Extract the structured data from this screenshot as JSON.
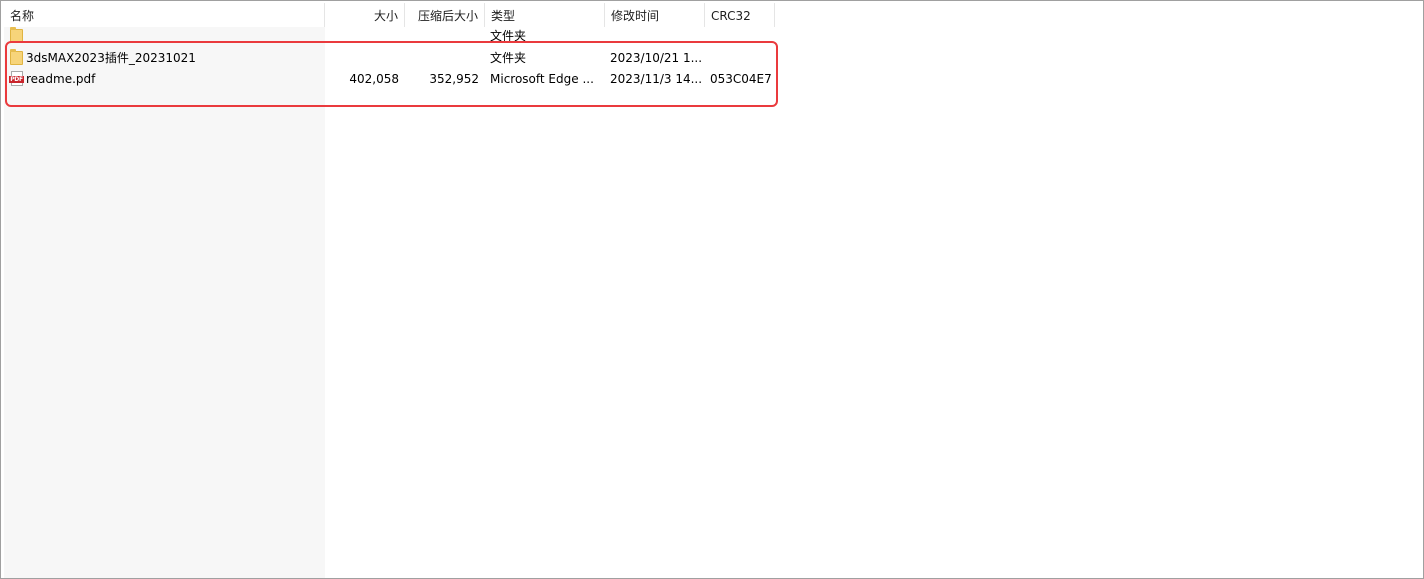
{
  "columns": {
    "name": "名称",
    "size": "大小",
    "packed_size": "压缩后大小",
    "type": "类型",
    "modified": "修改时间",
    "crc": "CRC32"
  },
  "rows": [
    {
      "icon": "folder-icon",
      "name": "",
      "size": "",
      "packed_size": "",
      "type": "文件夹",
      "modified": "",
      "crc": ""
    },
    {
      "icon": "folder-icon",
      "name": "3dsMAX2023插件_20231021",
      "size": "",
      "packed_size": "",
      "type": "文件夹",
      "modified": "2023/10/21 1...",
      "crc": ""
    },
    {
      "icon": "pdf-icon",
      "icon_label": "PDF",
      "name": "readme.pdf",
      "size": "402,058",
      "packed_size": "352,952",
      "type": "Microsoft Edge ...",
      "modified": "2023/11/3 14...",
      "crc": "053C04E7"
    }
  ],
  "colors": {
    "highlight_border": "#ea3a3d",
    "name_column_bg": "#f7f7f7",
    "folder": "#f7d47a",
    "pdf_tag": "#c9252c"
  }
}
